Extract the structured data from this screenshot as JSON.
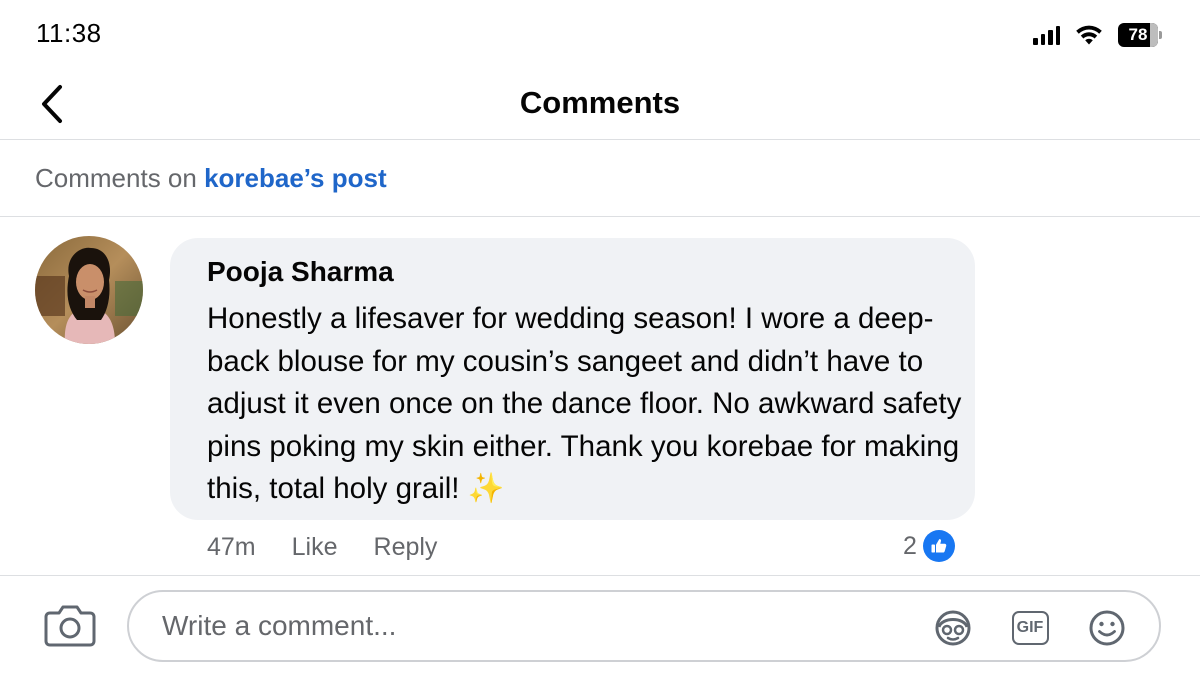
{
  "status_bar": {
    "time": "11:38",
    "battery": "78",
    "icons": [
      "cellular-signal-icon",
      "wifi-icon",
      "battery-icon"
    ]
  },
  "header": {
    "title": "Comments",
    "back_icon": "chevron-left-icon"
  },
  "subheader": {
    "prefix": "Comments on",
    "post_link": "korebae’s post"
  },
  "comment": {
    "author": "Pooja Sharma",
    "text": "Honestly a lifesaver for wedding season! I wore a deep-back blouse for my cousin’s sangeet and didn’t have to adjust it even once on the dance floor. No awkward safety pins poking my skin either. Thank you korebae for making this, total holy grail! ✨",
    "time": "47m",
    "like_label": "Like",
    "reply_label": "Reply",
    "reaction_count": "2",
    "reaction_icon": "thumbs-up-icon"
  },
  "composer": {
    "placeholder": "Write a comment...",
    "value": "",
    "icons": [
      "camera-icon",
      "avatar-sticker-icon",
      "gif-icon",
      "smiley-icon"
    ],
    "gif_label": "GIF"
  },
  "colors": {
    "link": "#1f66c9",
    "like_blue": "#1877f2",
    "bubble_bg": "#f0f2f5",
    "secondary_text": "#65676b",
    "divider": "#dddfe2"
  }
}
